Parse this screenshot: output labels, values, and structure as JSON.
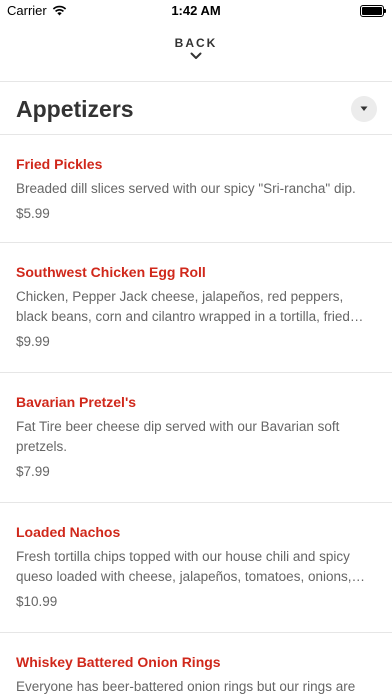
{
  "status": {
    "carrier": "Carrier",
    "time": "1:42 AM"
  },
  "nav": {
    "back_label": "BACK"
  },
  "section": {
    "title": "Appetizers"
  },
  "items": [
    {
      "name": "Fried Pickles",
      "description": "Breaded dill slices served with our spicy \"Sri-rancha\" dip.",
      "price": "$5.99"
    },
    {
      "name": "Southwest Chicken Egg Roll",
      "description": "Chicken, Pepper Jack cheese, jalapeños, red peppers, black beans, corn and cilantro wrapped in a tortilla, fried…",
      "price": "$9.99"
    },
    {
      "name": "Bavarian Pretzel's",
      "description": "Fat Tire beer cheese dip served with our Bavarian soft pretzels.",
      "price": "$7.99"
    },
    {
      "name": "Loaded Nachos",
      "description": "Fresh tortilla chips topped with our house chili and spicy queso loaded with cheese, jalapeños, tomatoes, onions,…",
      "price": "$10.99"
    },
    {
      "name": "Whiskey Battered Onion Rings",
      "description": "Everyone has beer-battered onion rings but our rings are",
      "price": ""
    }
  ],
  "colors": {
    "accent": "#d0281b",
    "text": "#333333",
    "muted": "#666666",
    "divider": "#e6e6e6"
  }
}
